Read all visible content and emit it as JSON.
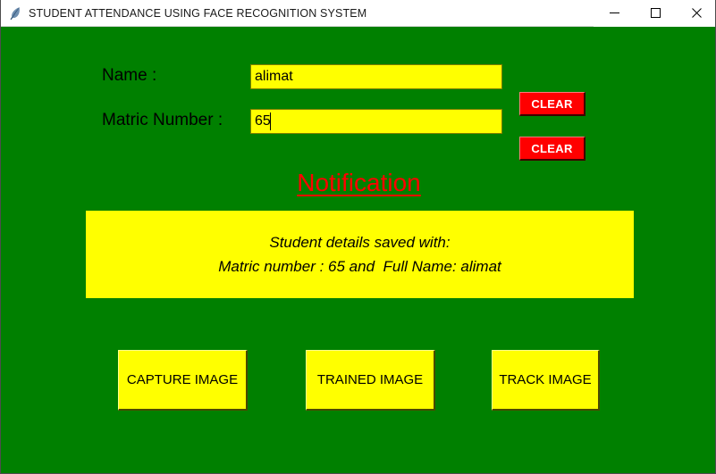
{
  "window": {
    "title": "STUDENT ATTENDANCE USING FACE RECOGNITION SYSTEM",
    "app_icon": "feather-icon",
    "background_color": "#008000",
    "titlebar_color": "#ffffff",
    "controls": {
      "minimize": "minimize-icon",
      "maximize": "maximize-icon",
      "close": "close-icon"
    }
  },
  "form": {
    "name": {
      "label": "Name :",
      "value": "alimat",
      "placeholder": "",
      "field_color": "#ffff00",
      "clear_label": "CLEAR"
    },
    "matric": {
      "label": "Matric Number :",
      "value": "65",
      "placeholder": "",
      "field_color": "#ffff00",
      "clear_label": "CLEAR"
    }
  },
  "notification": {
    "heading": "Notification",
    "heading_color": "#ff0000",
    "box_color": "#ffff00",
    "lines": [
      "Student details saved with:",
      "Matric number : 65 and  Full Name: alimat"
    ]
  },
  "actions": {
    "capture": "CAPTURE IMAGE",
    "trained": "TRAINED IMAGE",
    "track": "TRACK IMAGE",
    "button_color": "#ffff00"
  }
}
